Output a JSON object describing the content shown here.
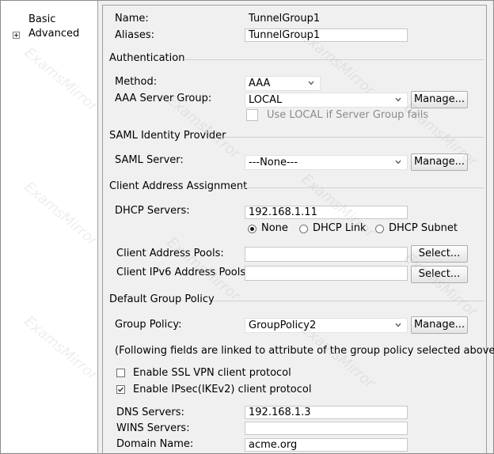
{
  "nav": {
    "items": [
      {
        "label": "Basic"
      },
      {
        "label": "Advanced"
      }
    ]
  },
  "basic": {
    "name_label": "Name:",
    "name_value": "TunnelGroup1",
    "aliases_label": "Aliases:",
    "aliases_value": "TunnelGroup1"
  },
  "authentication": {
    "section_title": "Authentication",
    "method_label": "Method:",
    "method_value": "AAA",
    "server_group_label": "AAA Server Group:",
    "server_group_value": "LOCAL",
    "manage_label": "Manage...",
    "use_local_label": "Use LOCAL if Server Group fails",
    "use_local_checked": false
  },
  "saml": {
    "section_title": "SAML Identity Provider",
    "server_label": "SAML Server:",
    "server_value": "---None---",
    "manage_label": "Manage..."
  },
  "client_address": {
    "section_title": "Client Address Assignment",
    "dhcp_label": "DHCP Servers:",
    "dhcp_value": "192.168.1.11",
    "radio_options": [
      "None",
      "DHCP Link",
      "DHCP Subnet"
    ],
    "radio_selected": "None",
    "pools_label": "Client Address Pools:",
    "pools_value": "",
    "ipv6_pools_label": "Client IPv6 Address Pools:",
    "ipv6_pools_value": "",
    "select_label": "Select..."
  },
  "group_policy": {
    "section_title": "Default Group Policy",
    "policy_label": "Group Policy:",
    "policy_value": "GroupPolicy2",
    "manage_label": "Manage...",
    "note": "(Following fields are linked to attribute of the group policy selected above.)",
    "ssl_label": "Enable SSL VPN client protocol",
    "ssl_checked": false,
    "ipsec_label": "Enable IPsec(IKEv2) client protocol",
    "ipsec_checked": true,
    "dns_label": "DNS Servers:",
    "dns_value": "192.168.1.3",
    "wins_label": "WINS Servers:",
    "wins_value": "",
    "domain_label": "Domain Name:",
    "domain_value": "acme.org"
  },
  "watermark": "ExamsMirror"
}
